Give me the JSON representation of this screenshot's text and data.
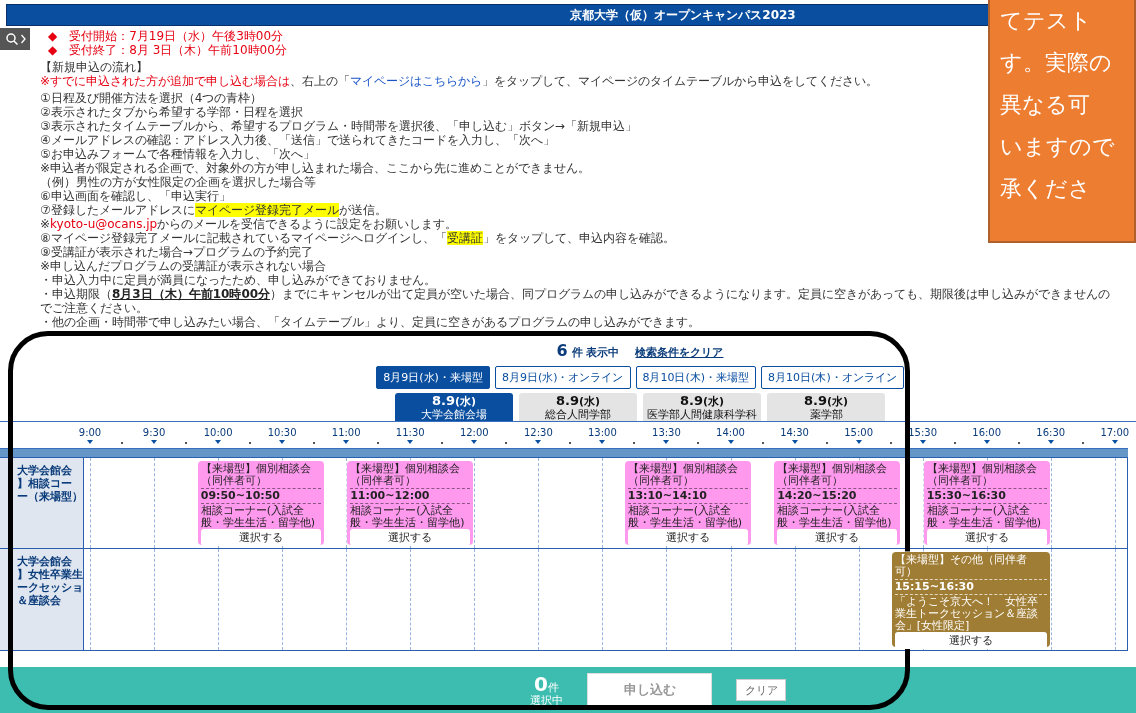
{
  "header": {
    "title": "京都大学（仮）オープンキャンパス2023"
  },
  "deadlines": [
    "◆　受付開始：7月19日（水）午後3時00分",
    "◆　受付終了：8月 3日（木）午前10時00分"
  ],
  "flow": {
    "heading": "【新規申込の流れ】",
    "note": [
      {
        "text": "※すでに申込された方が追加で申し込む場合は",
        "kind": "warning"
      },
      {
        "text": "、右上の「",
        "kind": "plain"
      },
      {
        "text": "マイページはこちらから",
        "kind": "link"
      },
      {
        "text": "」をタップして、マイページのタイムテーブルから申込をしてください。",
        "kind": "plain"
      }
    ],
    "steps": [
      [
        {
          "text": "①日程及び開催方法を選択（4つの青枠）",
          "kind": "plain"
        }
      ],
      [
        {
          "text": "②表示されたタブから希望する学部・日程を選択",
          "kind": "plain"
        }
      ],
      [
        {
          "text": "③表示されたタイムテーブルから、希望するプログラム・時間帯を選択後、「申し込む」ボタン→「新規申込」",
          "kind": "plain"
        }
      ],
      [
        {
          "text": "④メールアドレスの確認：アドレス入力後、「送信」で送られてきたコードを入力し、「次へ」",
          "kind": "plain"
        }
      ],
      [
        {
          "text": "⑤お申込みフォームで各種情報を入力し、「次へ」",
          "kind": "plain"
        }
      ],
      [
        {
          "text": "※申込者が限定される企画で、対象外の方が申し込まれた場合、ここから先に進めことができません。",
          "kind": "plain"
        }
      ],
      [
        {
          "text": "（例）男性の方が女性限定の企画を選択した場合等",
          "kind": "plain"
        }
      ],
      [
        {
          "text": "⑥申込画面を確認し、「申込実行」",
          "kind": "plain"
        }
      ],
      [
        {
          "text": "⑦登録したメールアドレスに",
          "kind": "plain"
        },
        {
          "text": "マイページ登録完了メール",
          "kind": "highlight"
        },
        {
          "text": "が送信。",
          "kind": "plain"
        }
      ],
      [
        {
          "text": "※",
          "kind": "plain"
        },
        {
          "text": "kyoto-u@ocans.jp",
          "kind": "warning"
        },
        {
          "text": "からのメールを受信できるように設定をお願いします。",
          "kind": "plain"
        }
      ],
      [
        {
          "text": "⑧マイページ登録完了メールに記載されているマイページへログインし、「",
          "kind": "plain"
        },
        {
          "text": "受講証",
          "kind": "highlight"
        },
        {
          "text": "」をタップして、申込内容を確認。",
          "kind": "plain"
        }
      ],
      [
        {
          "text": "⑨受講証が表示された場合→プログラムの予約完了",
          "kind": "plain"
        }
      ],
      [
        {
          "text": "※申し込んだプログラムの受講証が表示されない場合",
          "kind": "plain"
        }
      ],
      [
        {
          "text": "・申込入力中に定員が満員になったため、申し込みができておりません。",
          "kind": "plain"
        }
      ],
      [
        {
          "text": "・申込期限（",
          "kind": "plain"
        },
        {
          "text": "8月3日（木）午前10時00分",
          "kind": "emphasis"
        },
        {
          "text": "）までにキャンセルが出て定員が空いた場合、同プログラムの申し込みができるようになります。定員に空きがあっても、期限後は申し込みができませんのでご注意ください。",
          "kind": "plain"
        }
      ],
      [
        {
          "text": "・他の企画・時間帯で申し込みたい場合、「タイムテーブル」より、定員に空きがあるプログラムの申し込みができます。",
          "kind": "plain"
        }
      ]
    ]
  },
  "results": {
    "count": "6",
    "count_unit": "件 表示中",
    "clear_link": "検索条件をクリア"
  },
  "filters": [
    {
      "label": "8月9日(水)・来場型",
      "selected": true
    },
    {
      "label": "8月9日(水)・オンライン",
      "selected": false
    },
    {
      "label": "8月10日(木)・来場型",
      "selected": false
    },
    {
      "label": "8月10日(木)・オンライン",
      "selected": false
    }
  ],
  "date_tabs": [
    {
      "date": "8.9",
      "weekday": "(水)",
      "sub": "大学会館会場",
      "selected": true
    },
    {
      "date": "8.9",
      "weekday": "(水)",
      "sub": "総合人間学部",
      "selected": false
    },
    {
      "date": "8.9",
      "weekday": "(水)",
      "sub": "医学部人間健康科学科",
      "selected": false
    },
    {
      "date": "8.9",
      "weekday": "(水)",
      "sub": "薬学部",
      "selected": false
    }
  ],
  "timeline": {
    "times": [
      "9:00",
      "9:30",
      "10:00",
      "10:30",
      "11:00",
      "11:30",
      "12:00",
      "12:30",
      "13:00",
      "13:30",
      "14:00",
      "14:30",
      "15:00",
      "15:30",
      "16:00",
      "16:30",
      "17:00"
    ],
    "rows": [
      {
        "label_lines": [
          "大学会館会",
          "】相談コー",
          "ー（来場型）"
        ],
        "sessions": [
          {
            "title": "【来場型】個別相談会（同伴者可）",
            "time": "09:50~10:50",
            "description": "相談コーナー(入試全般・学生生活・留学他)",
            "button": "選択する",
            "color": "#ff99ee"
          },
          {
            "title": "【来場型】個別相談会（同伴者可）",
            "time": "11:00~12:00",
            "description": "相談コーナー(入試全般・学生生活・留学他)",
            "button": "選択する",
            "color": "#ff99ee"
          },
          {
            "title": "【来場型】個別相談会（同伴者可）",
            "time": "13:10~14:10",
            "description": "相談コーナー(入試全般・学生生活・留学他)",
            "button": "選択する",
            "color": "#ff99ee"
          },
          {
            "title": "【来場型】個別相談会（同伴者可）",
            "time": "14:20~15:20",
            "description": "相談コーナー(入試全般・学生生活・留学他)",
            "button": "選択する",
            "color": "#ff99ee"
          },
          {
            "title": "【来場型】個別相談会（同伴者可）",
            "time": "15:30~16:30",
            "description": "相談コーナー(入試全般・学生生活・留学他)",
            "button": "選択する",
            "color": "#ff99ee"
          }
        ]
      },
      {
        "label_lines": [
          "大学会館会",
          "】女性卒業生",
          "ークセッショ",
          "＆座談会"
        ],
        "sessions": [
          {
            "title": "【来場型】その他（同伴者可）",
            "time": "15:15~16:30",
            "description": "「ようこそ京大へ！　女性卒業生トークセッション＆座談会」[女性限定]",
            "button": "選択する",
            "color": "#a07d35"
          }
        ]
      }
    ]
  },
  "selection_bar": {
    "count": "0",
    "unit": "件",
    "caption": "選択中",
    "apply_button": "申し込む",
    "apply_disabled": true,
    "clear_button": "クリア"
  },
  "overlay_note": {
    "lines": [
      "てテスト",
      "す。実際の",
      "異なる可",
      "いますので",
      "承くださ"
    ]
  }
}
